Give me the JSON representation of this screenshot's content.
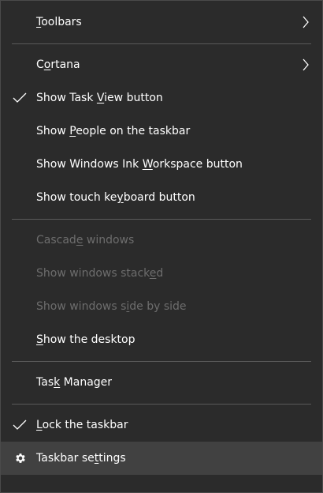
{
  "menu": {
    "toolbars": {
      "pre": "",
      "key": "T",
      "post": "oolbars"
    },
    "cortana": {
      "pre": "C",
      "key": "o",
      "post": "rtana"
    },
    "task_view": {
      "pre": "Show Task ",
      "key": "V",
      "post": "iew button"
    },
    "people": {
      "pre": "Show ",
      "key": "P",
      "post": "eople on the taskbar"
    },
    "ink": {
      "pre": "Show Windows Ink ",
      "key": "W",
      "post": "orkspace button"
    },
    "touch_keyboard": {
      "pre": "Show touch ke",
      "key": "y",
      "post": "board button"
    },
    "cascade": {
      "pre": "Cascad",
      "key": "e",
      "post": " windows"
    },
    "stacked": {
      "pre": "Show windows stack",
      "key": "e",
      "post": "d"
    },
    "side_by_side": {
      "pre": "Show windows s",
      "key": "i",
      "post": "de by side"
    },
    "desktop": {
      "pre": "",
      "key": "S",
      "post": "how the desktop"
    },
    "task_manager": {
      "pre": "Tas",
      "key": "k",
      "post": " Manager"
    },
    "lock": {
      "pre": "",
      "key": "L",
      "post": "ock the taskbar"
    },
    "settings": {
      "pre": "Taskbar se",
      "key": "t",
      "post": "tings"
    }
  },
  "colors": {
    "background": "#2b2b2b",
    "text": "#ffffff",
    "disabled_text": "#6d6d6d",
    "separator": "#5a5a5a",
    "hover": "#414141"
  }
}
